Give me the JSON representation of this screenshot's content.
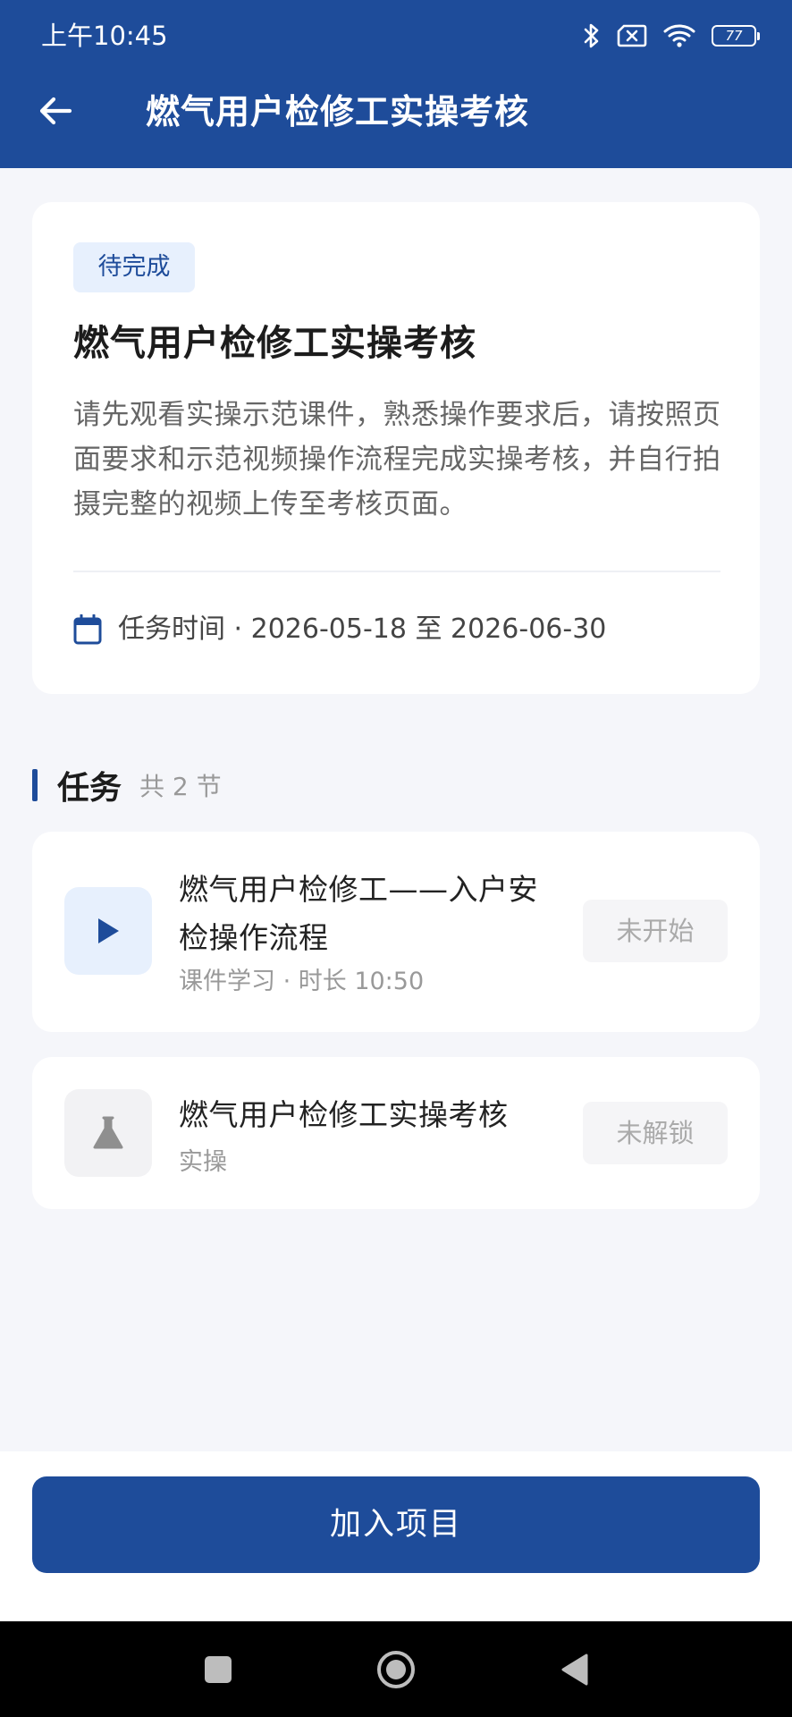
{
  "status_bar": {
    "time": "上午10:45",
    "battery": "77",
    "icons": [
      "bluetooth-icon",
      "no-sim-icon",
      "wifi-icon",
      "battery-icon"
    ]
  },
  "nav": {
    "back_icon": "arrow-left-icon",
    "title": "燃气用户检修工实操考核"
  },
  "info_card": {
    "badge": "待完成",
    "title": "燃气用户检修工实操考核",
    "description": "请先观看实操示范课件，熟悉操作要求后，请按照页面要求和示范视频操作流程完成实操考核，并自行拍摄完整的视频上传至考核页面。",
    "task_time": "任务时间 · 2026-05-18 至 2026-06-30",
    "calendar_icon": "calendar-icon"
  },
  "tasks_section": {
    "title": "任务",
    "count": "共 2 节",
    "items": [
      {
        "icon": "play-icon",
        "name": "燃气用户检修工——入户安检操作流程",
        "meta": "课件学习 · 时长 10:50",
        "status": "未开始"
      },
      {
        "icon": "flask-icon",
        "name": "燃气用户检修工实操考核",
        "meta": "实操",
        "status": "未解锁"
      }
    ]
  },
  "bottom": {
    "join_label": "加入项目"
  },
  "colors": {
    "primary": "#1e4c9a",
    "badge_bg": "#e7f0fd",
    "page_bg": "#f5f6fa"
  },
  "system_nav": [
    "recents-square-icon",
    "home-circle-icon",
    "back-triangle-icon"
  ]
}
